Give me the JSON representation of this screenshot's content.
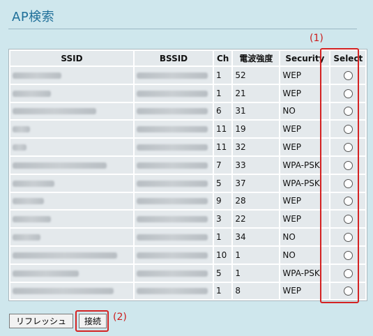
{
  "page": {
    "title": "AP検索"
  },
  "annotations": {
    "marker_1": "(1)",
    "marker_2": "(2)"
  },
  "table": {
    "headers": {
      "ssid": "SSID",
      "bssid": "BSSID",
      "ch": "Ch",
      "signal": "電波強度",
      "security": "Security",
      "select": "Select"
    },
    "rows": [
      {
        "ch": "1",
        "signal": "52",
        "security": "WEP"
      },
      {
        "ch": "1",
        "signal": "21",
        "security": "WEP"
      },
      {
        "ch": "6",
        "signal": "31",
        "security": "NO"
      },
      {
        "ch": "11",
        "signal": "19",
        "security": "WEP"
      },
      {
        "ch": "11",
        "signal": "32",
        "security": "WEP"
      },
      {
        "ch": "7",
        "signal": "33",
        "security": "WPA-PSK"
      },
      {
        "ch": "5",
        "signal": "37",
        "security": "WPA-PSK"
      },
      {
        "ch": "9",
        "signal": "28",
        "security": "WEP"
      },
      {
        "ch": "3",
        "signal": "22",
        "security": "WEP"
      },
      {
        "ch": "1",
        "signal": "34",
        "security": "NO"
      },
      {
        "ch": "10",
        "signal": "1",
        "security": "NO"
      },
      {
        "ch": "5",
        "signal": "1",
        "security": "WPA-PSK"
      },
      {
        "ch": "1",
        "signal": "8",
        "security": "WEP"
      }
    ]
  },
  "buttons": {
    "refresh": "リフレッシュ",
    "connect": "接続"
  },
  "colors": {
    "background": "#cfe7ed",
    "title": "#1f6f99",
    "highlight": "#d42222"
  }
}
